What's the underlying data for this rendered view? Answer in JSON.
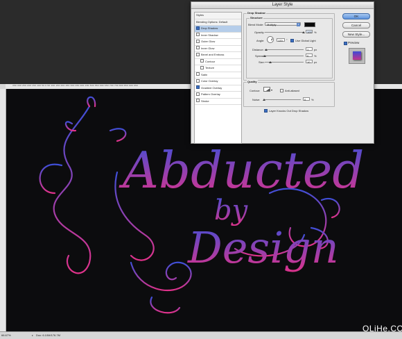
{
  "workspace": {
    "ruler_ticks": "350  300  250  200  150  100   50    0    50   100   150   200   250   300   350   400   450   500   550   600   650   700   750   800   850   900   950",
    "zoom": "66.67%",
    "doc_size": "Doc: 6.10M/176.7M",
    "watermark": "OLiHe.COM"
  },
  "artwork": {
    "line1": "Abducted",
    "line2": "by",
    "line3": "Design",
    "gradient_top": "#3e4fd8",
    "gradient_bottom": "#e0328a"
  },
  "dialog": {
    "title": "Layer Style",
    "styles": [
      {
        "label": "Styles",
        "checkbox": false,
        "header": true
      },
      {
        "label": "Blending Options: Default",
        "checkbox": false,
        "header": true
      },
      {
        "label": "Drop Shadow",
        "checkbox": true,
        "checked": true,
        "selected": true
      },
      {
        "label": "Inner Shadow",
        "checkbox": true,
        "checked": false
      },
      {
        "label": "Outer Glow",
        "checkbox": true,
        "checked": false
      },
      {
        "label": "Inner Glow",
        "checkbox": true,
        "checked": false
      },
      {
        "label": "Bevel and Emboss",
        "checkbox": true,
        "checked": false
      },
      {
        "label": "Contour",
        "checkbox": true,
        "checked": false,
        "indent": true
      },
      {
        "label": "Texture",
        "checkbox": true,
        "checked": false,
        "indent": true
      },
      {
        "label": "Satin",
        "checkbox": true,
        "checked": false
      },
      {
        "label": "Color Overlay",
        "checkbox": true,
        "checked": false
      },
      {
        "label": "Gradient Overlay",
        "checkbox": true,
        "checked": true
      },
      {
        "label": "Pattern Overlay",
        "checkbox": true,
        "checked": false
      },
      {
        "label": "Stroke",
        "checkbox": true,
        "checked": false
      }
    ],
    "drop_shadow": {
      "group_title": "Drop Shadow",
      "structure_title": "Structure",
      "blend_mode_label": "Blend Mode:",
      "blend_mode_value": "Multiply",
      "shadow_color": "#0a0a0a",
      "opacity_label": "Opacity:",
      "opacity_value": "100",
      "opacity_level": 1.0,
      "opacity_unit": "%",
      "angle_label": "Angle:",
      "angle_value": "120",
      "angle_unit": "°",
      "global_light_label": "Use Global Light",
      "distance_label": "Distance:",
      "distance_value": "1",
      "distance_unit": "px",
      "spread_label": "Spread:",
      "spread_value": "0",
      "spread_unit": "%",
      "size_label": "Size:",
      "size_value": "10",
      "size_unit": "px",
      "quality_title": "Quality",
      "contour_label": "Contour:",
      "antialiased_label": "Anti-aliased",
      "noise_label": "Noise:",
      "noise_value": "0",
      "noise_unit": "%",
      "knockout_label": "Layer Knocks Out Drop Shadow"
    },
    "buttons": {
      "ok": "OK",
      "cancel": "Cancel",
      "new_style": "New Style...",
      "preview": "Preview"
    }
  }
}
